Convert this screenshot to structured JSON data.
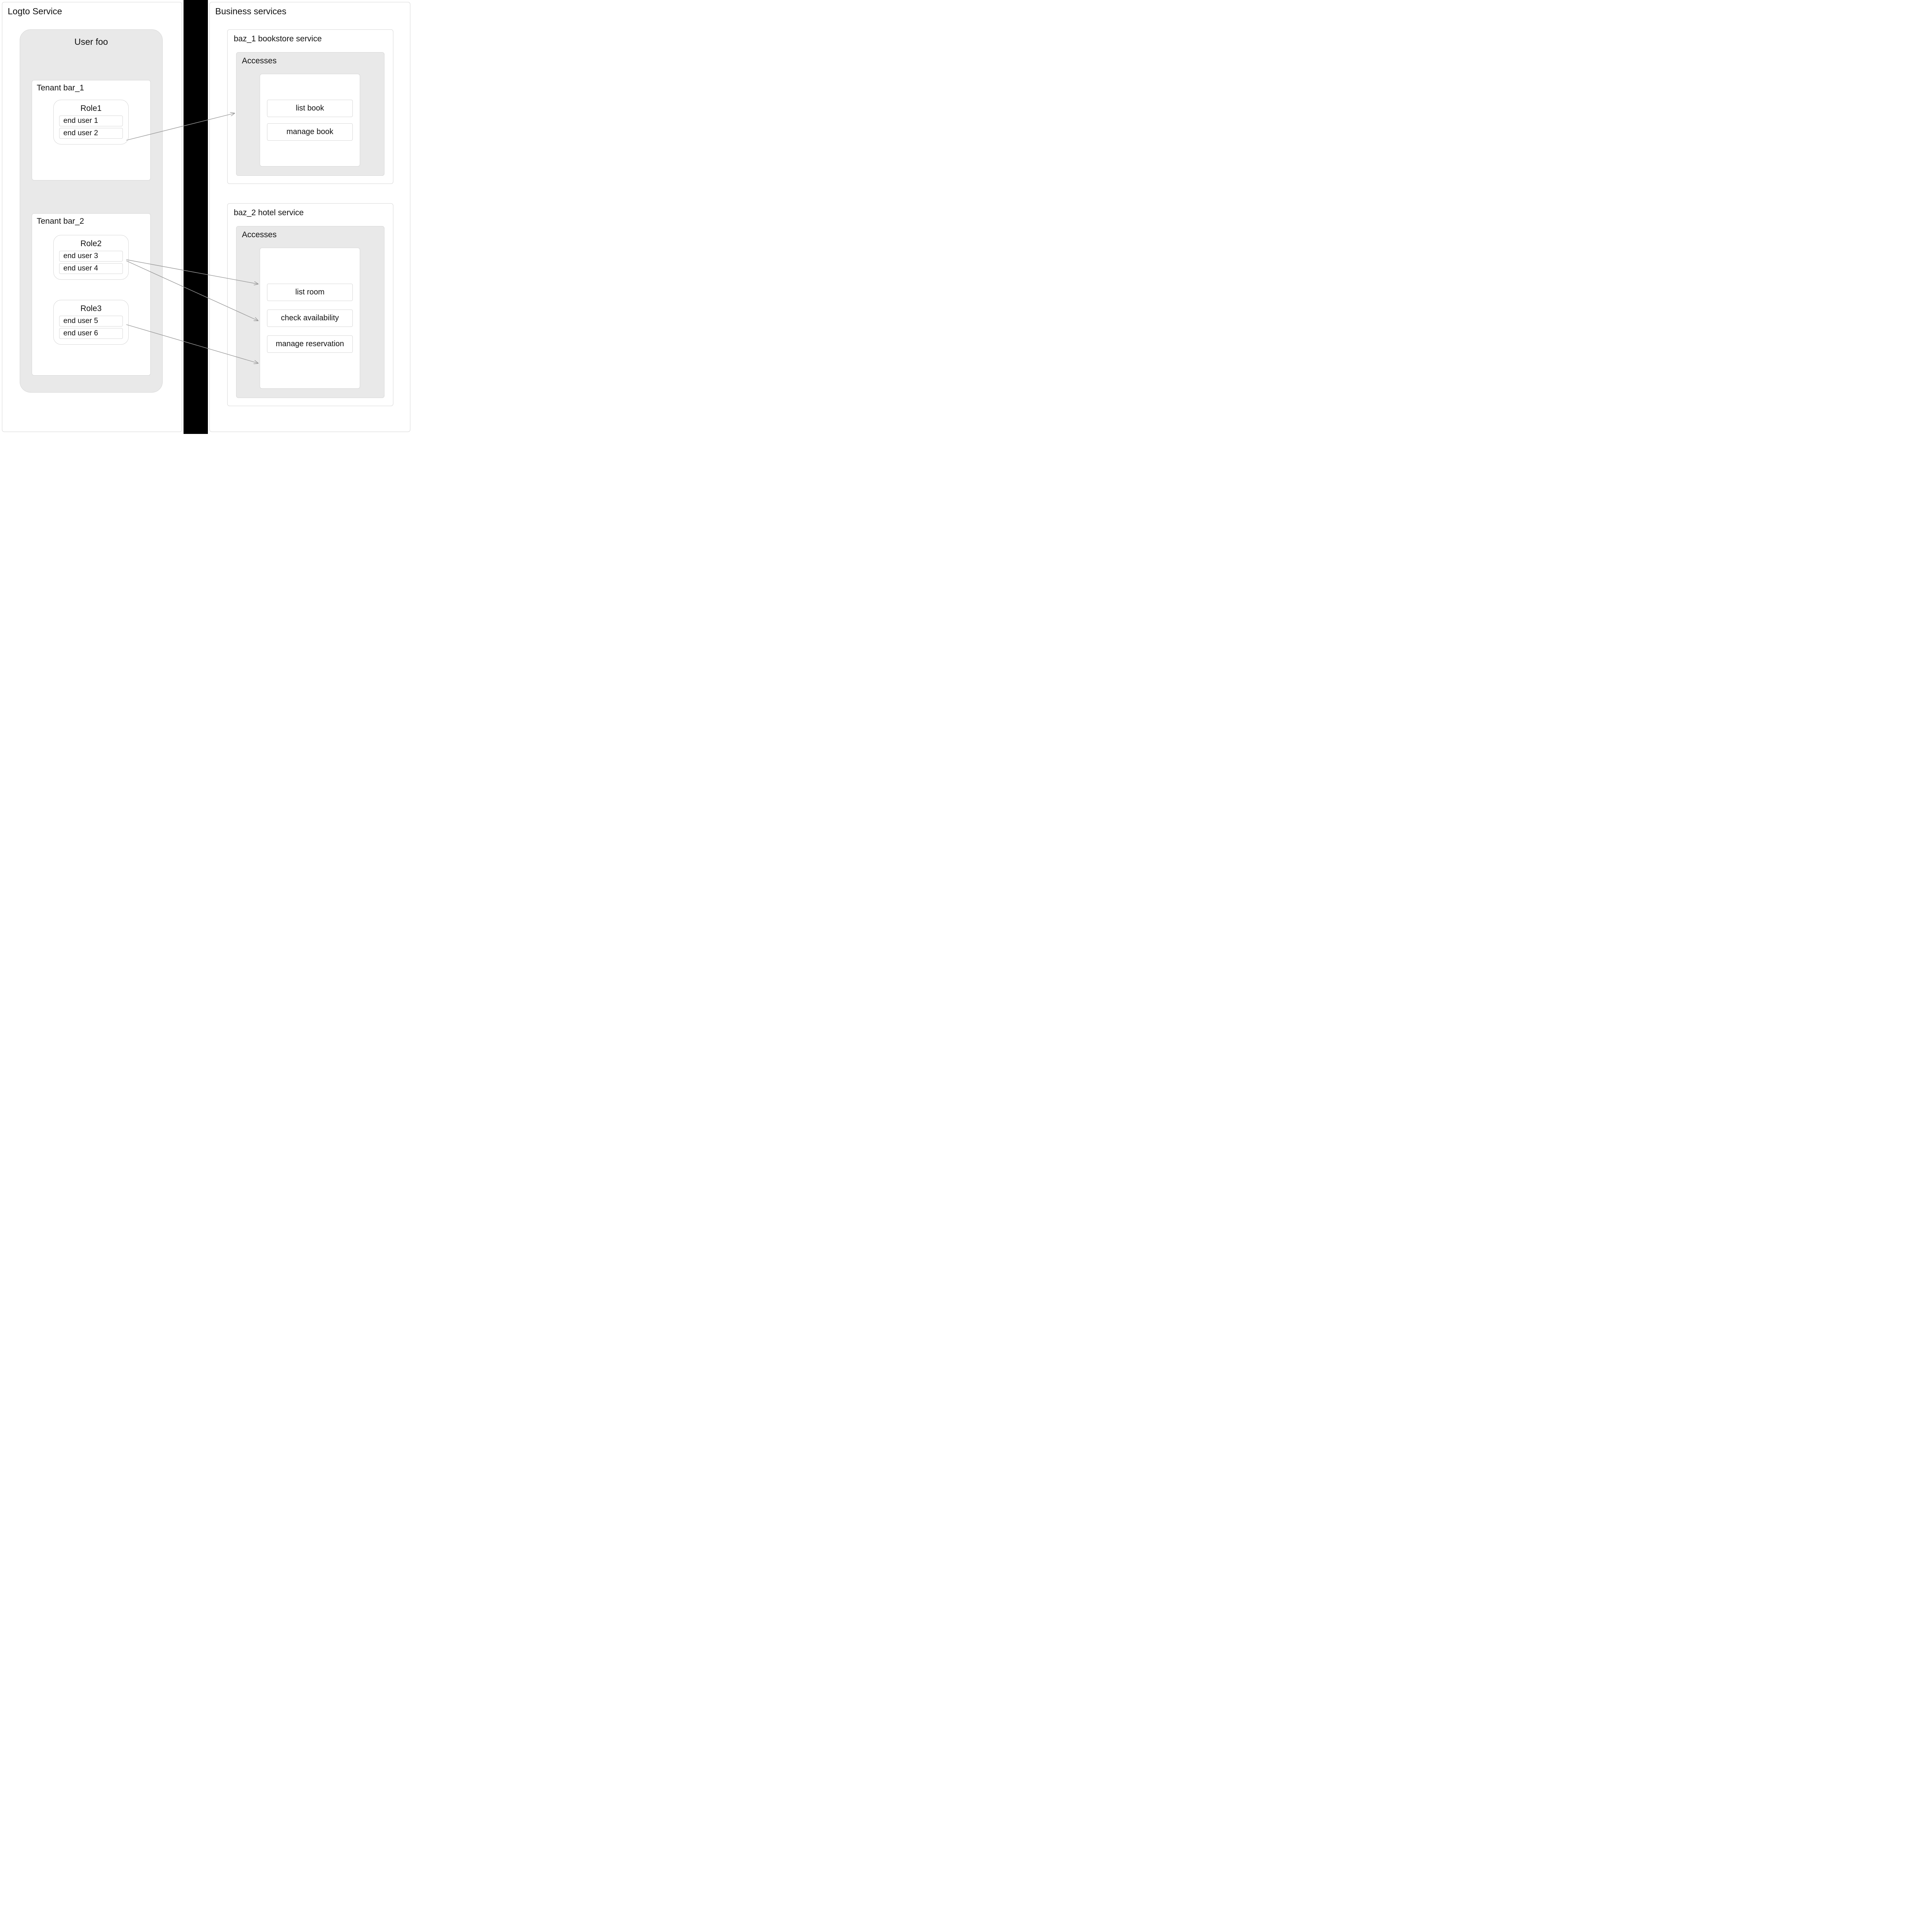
{
  "left_panel": {
    "title": "Logto Service",
    "user": {
      "title": "User foo",
      "tenants": [
        {
          "title": "Tenant bar_1",
          "roles": [
            {
              "title": "Role1",
              "users": [
                "end user 1",
                "end user 2"
              ]
            }
          ]
        },
        {
          "title": "Tenant bar_2",
          "roles": [
            {
              "title": "Role2",
              "users": [
                "end user 3",
                "end user 4"
              ]
            },
            {
              "title": "Role3",
              "users": [
                "end user 5",
                "end user 6"
              ]
            }
          ]
        }
      ]
    }
  },
  "right_panel": {
    "title": "Business services",
    "services": [
      {
        "title": "baz_1 bookstore service",
        "accesses_label": "Accesses",
        "permissions": [
          "list book",
          "manage book"
        ]
      },
      {
        "title": "baz_2 hotel service",
        "accesses_label": "Accesses",
        "permissions": [
          "list room",
          "check availability",
          "manage reservation"
        ]
      }
    ]
  },
  "arrows": [
    {
      "from": "role1",
      "to": "accesses1"
    },
    {
      "from": "role2",
      "to": "perm-list-room"
    },
    {
      "from": "role2",
      "to": "perm-check-availability"
    },
    {
      "from": "role3",
      "to": "perm-manage-reservation"
    }
  ]
}
